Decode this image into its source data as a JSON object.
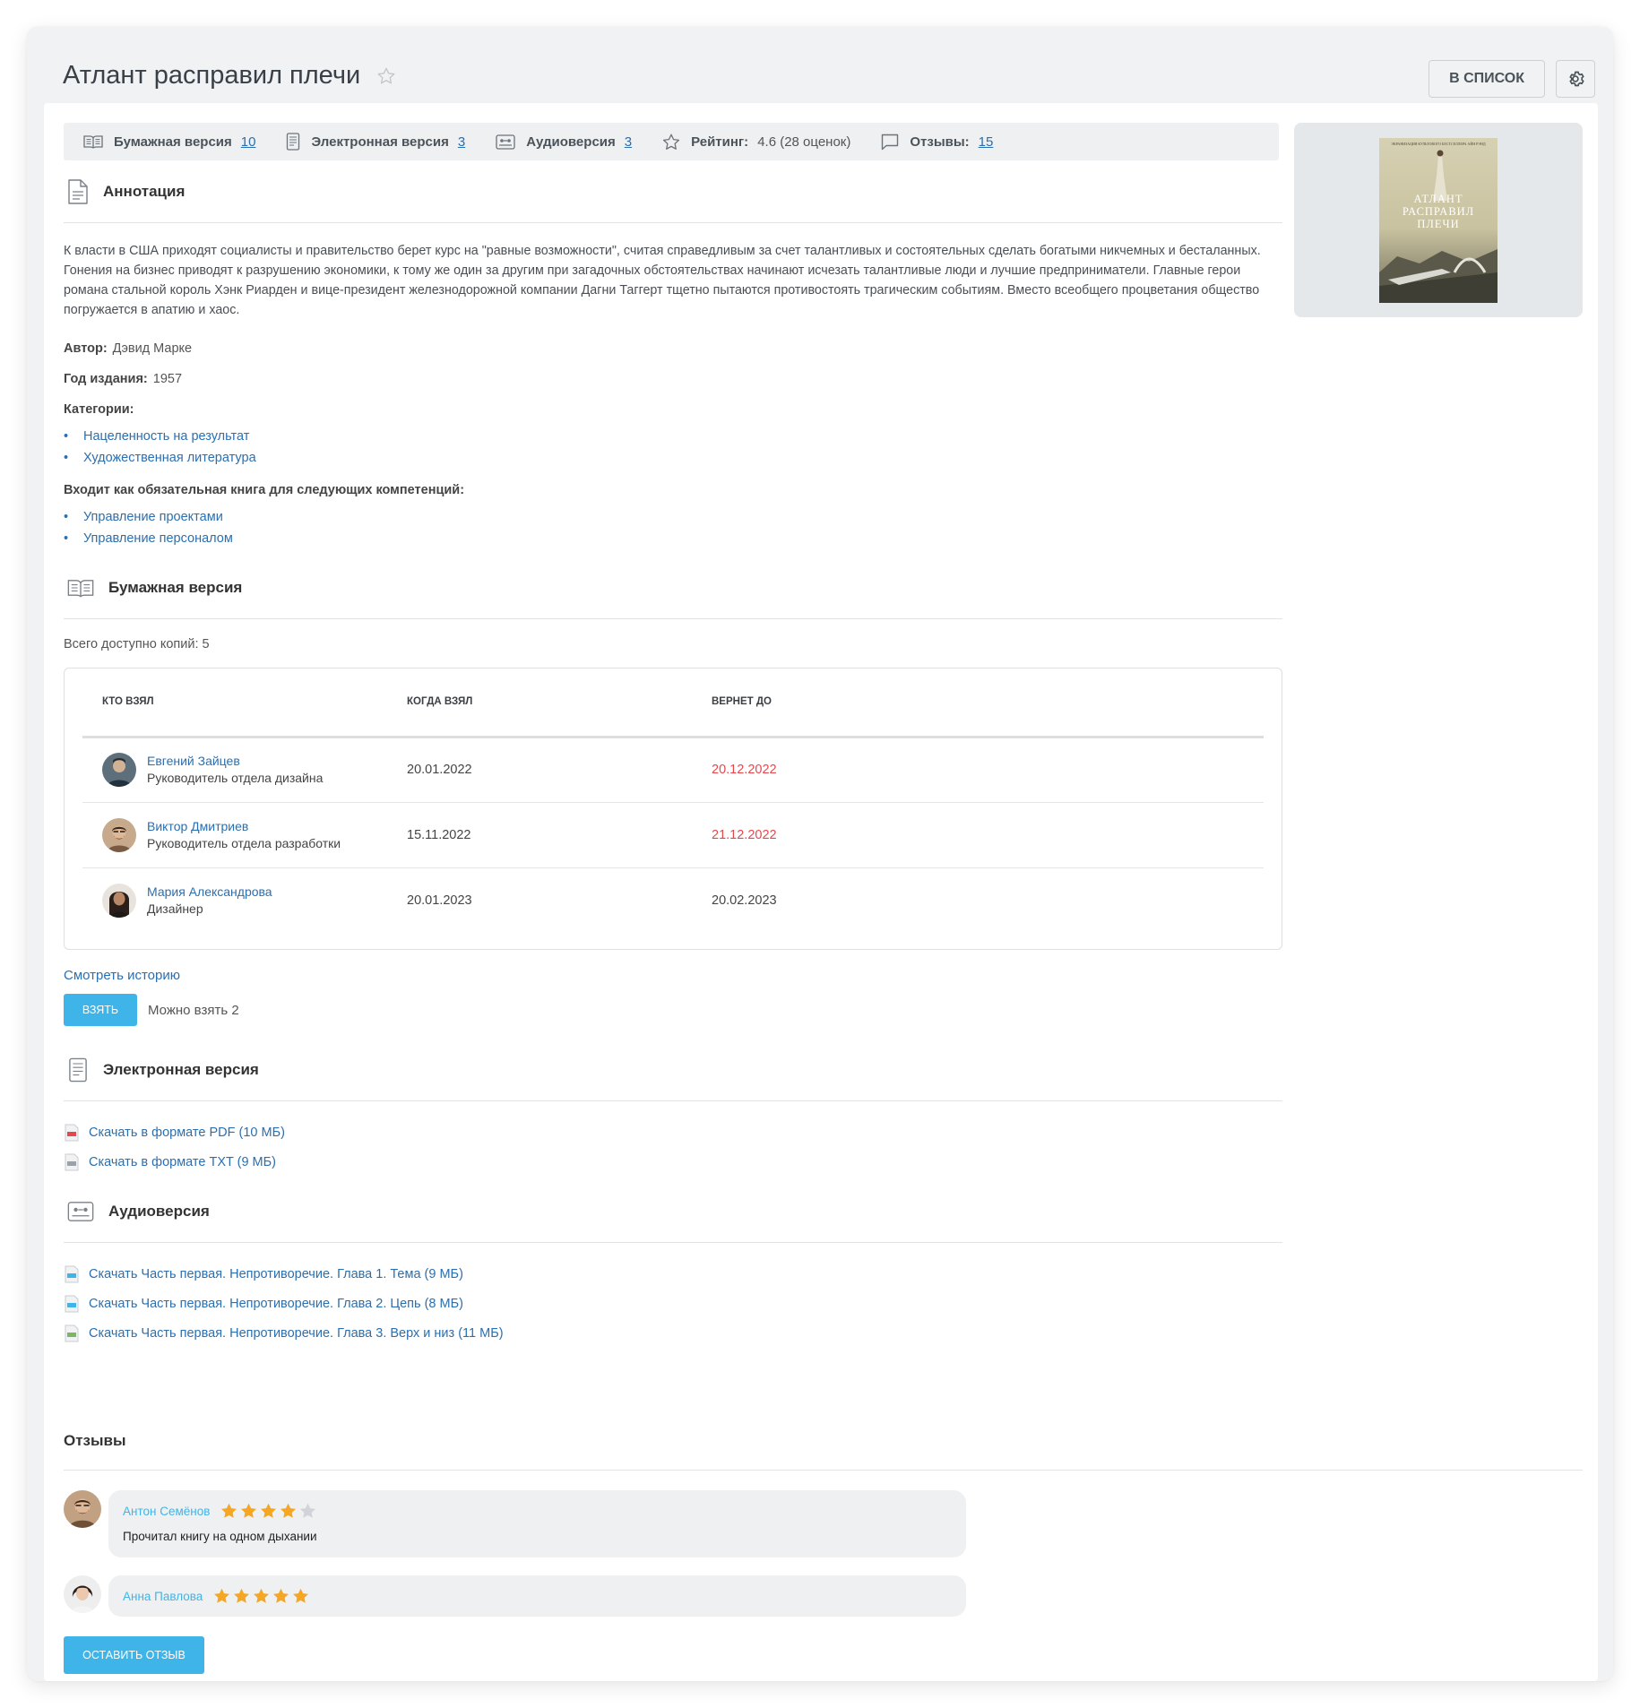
{
  "header": {
    "title": "Атлант расправил плечи",
    "to_list_label": "В СПИСОК"
  },
  "infobar": {
    "paper_label": "Бумажная версия",
    "paper_count": "10",
    "ebook_label": "Электронная версия",
    "ebook_count": "3",
    "audio_label": "Аудиоверсия",
    "audio_count": "3",
    "rating_label": "Рейтинг:",
    "rating_value": "4.6 (28 оценок)",
    "reviews_label": "Отзывы:",
    "reviews_count": "15"
  },
  "cover": {
    "top_line": "ЭКРАНИЗАЦИЯ КУЛЬТОВОГО БЕСТСЕЛЛЕРА АЙН РЭНД",
    "title_line1": "АТЛАНТ",
    "title_line2": "РАСПРАВИЛ",
    "title_line3": "ПЛЕЧИ"
  },
  "annotation": {
    "title": "Аннотация",
    "text": "К власти в США приходят социалисты и правительство берет курс на \"равные возможности\", считая справедливым за счет талантливых и состоятельных сделать богатыми никчемных и бесталанных. Гонения на бизнес приводят к разрушению экономики, к тому же один за другим при загадочных обстоятельствах начинают исчезать талантливые люди и лучшие предприниматели. Главные герои романа стальной король Хэнк Риарден и вице-президент железнодорожной компании Дагни Таггерт тщетно пытаются противостоять трагическим событиям. Вместо всеобщего процветания общество погружается в апатию и хаос.",
    "author_label": "Автор:",
    "author": "Дэвид Марке",
    "year_label": "Год издания:",
    "year": "1957",
    "categories_label": "Категории:",
    "categories": [
      "Нацеленность на результат",
      "Художественная литература"
    ],
    "competencies_label": "Входит как обязательная книга для следующих компетенций:",
    "competencies": [
      "Управление проектами",
      "Управление персоналом"
    ]
  },
  "paper": {
    "title": "Бумажная версия",
    "copies": "Всего доступно копий: 5",
    "columns": [
      "КТО ВЗЯЛ",
      "КОГДА ВЗЯЛ",
      "ВЕРНЕТ ДО"
    ],
    "rows": [
      {
        "name": "Евгений Зайцев",
        "role": "Руководитель отдела дизайна",
        "taken": "20.01.2022",
        "return": "20.12.2022"
      },
      {
        "name": "Виктор Дмитриев",
        "role": "Руководитель отдела разработки",
        "taken": "15.11.2022",
        "return": "21.12.2022"
      },
      {
        "name": "Мария Александрова",
        "role": "Дизайнер",
        "taken": "20.01.2023",
        "return": "20.02.2023"
      }
    ],
    "history_link": "Смотреть историю",
    "take_label": "ВЗЯТЬ",
    "take_note": "Можно взять 2"
  },
  "ebook": {
    "title": "Электронная версия",
    "files": [
      "Скачать в формате PDF (10 МБ)",
      "Скачать в формате TXT (9 МБ)"
    ]
  },
  "audio": {
    "title": "Аудиоверсия",
    "files": [
      "Скачать Часть первая. Непротиворечие. Глава 1. Тема (9 МБ)",
      "Скачать Часть первая. Непротиворечие. Глава 2. Цепь (8 МБ)",
      "Скачать Часть первая. Непротиворечие. Глава 3. Верх и низ (11 МБ)"
    ]
  },
  "reviews": {
    "title": "Отзывы",
    "items": [
      {
        "name": "Антон Семёнов",
        "stars": 4,
        "text": "Прочитал книгу на одном дыхании"
      },
      {
        "name": "Анна Павлова",
        "stars": 5,
        "text": ""
      }
    ],
    "leave_label": "ОСТАВИТЬ ОТЗЫВ"
  },
  "colors": {
    "accent": "#3fb4e8",
    "link": "#2a6fb0",
    "overdue": "#e5484d",
    "star": "#f5a623",
    "star_empty": "#d0d4d8"
  }
}
